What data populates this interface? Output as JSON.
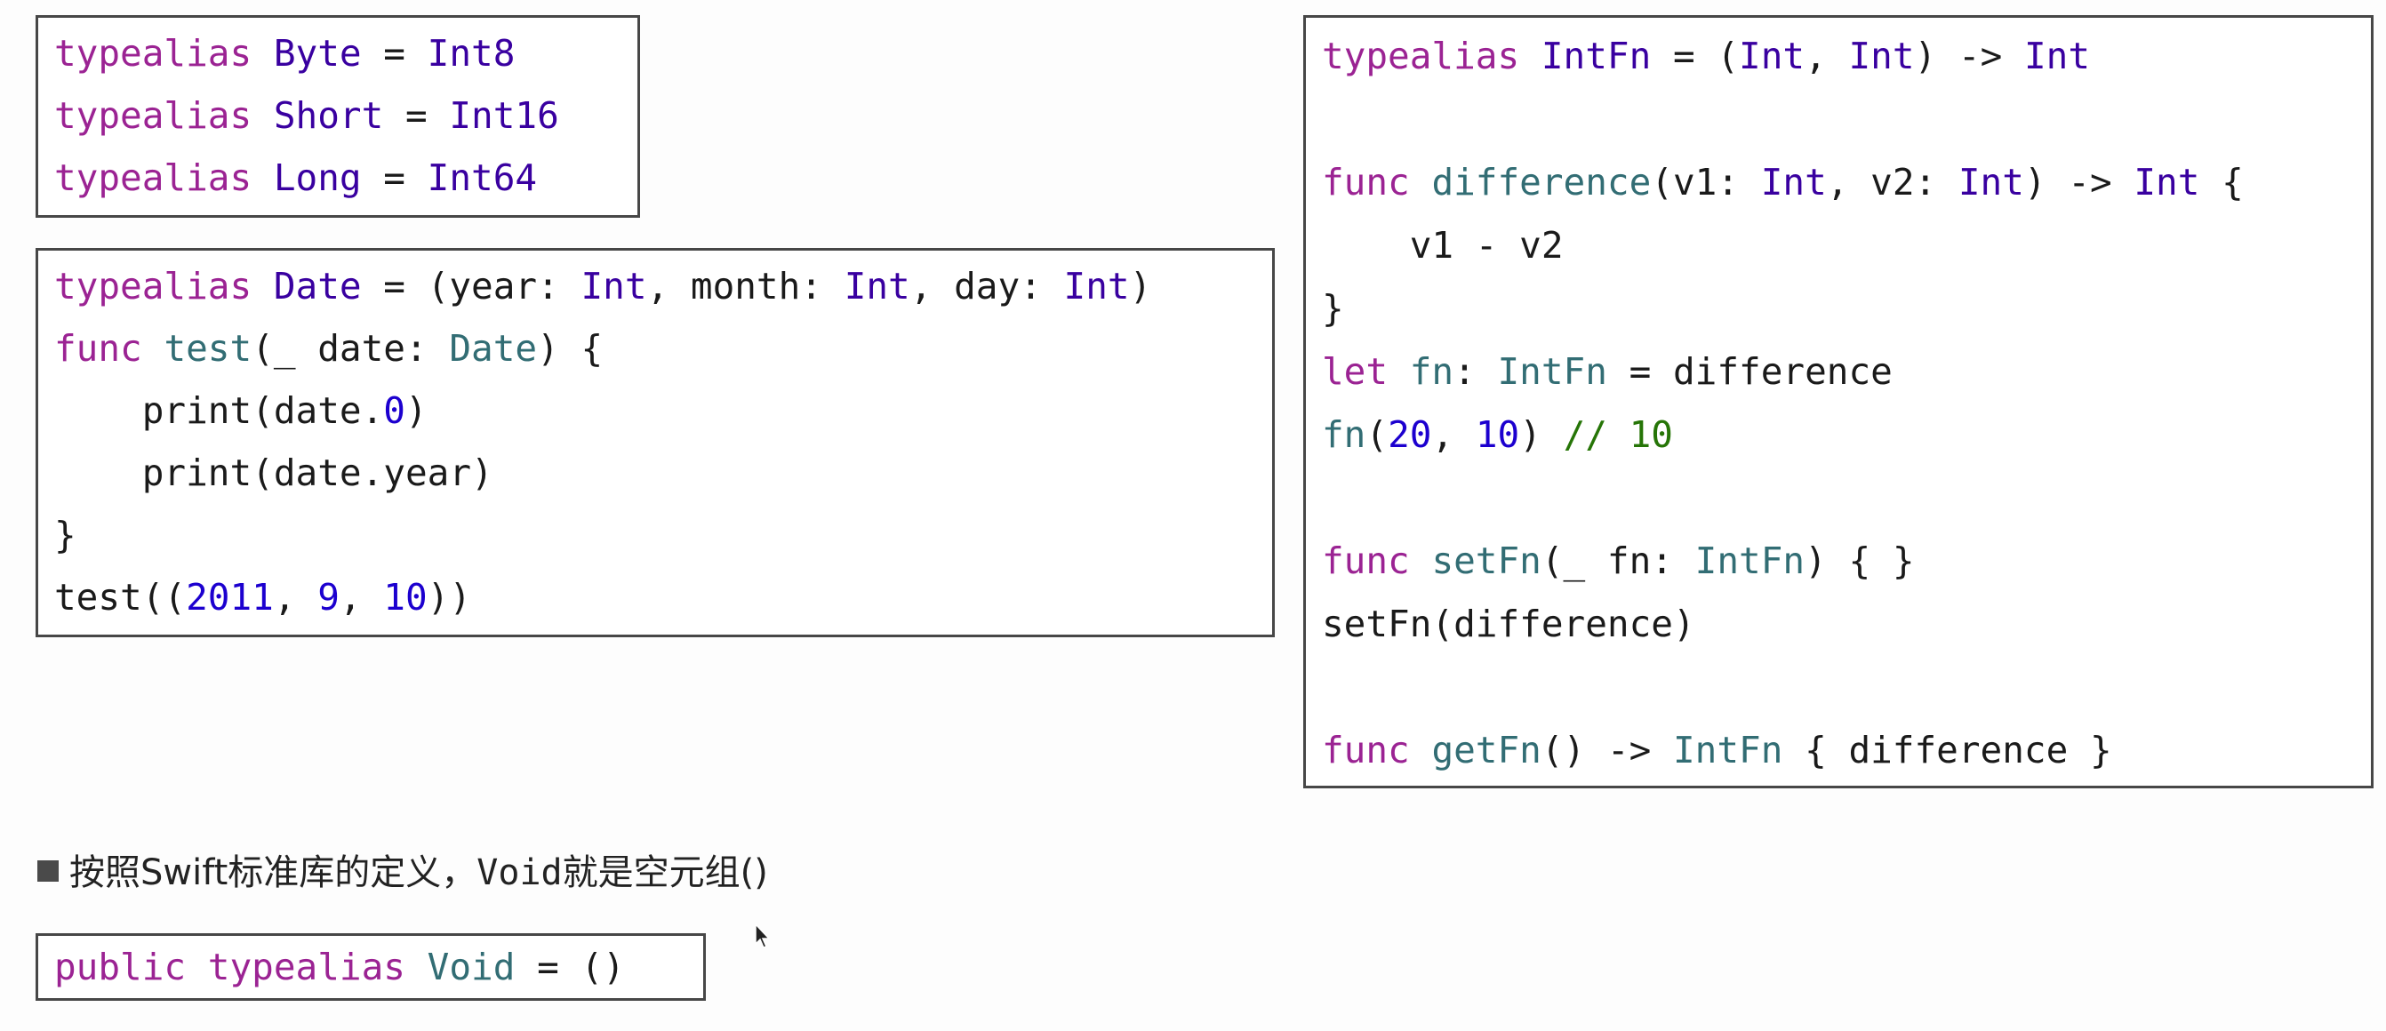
{
  "colors": {
    "keyword": "#9b2393",
    "type": "#3900a0",
    "identifier": "#326d74",
    "number": "#1c00cf",
    "comment": "#267507",
    "plain": "#1a1a1a",
    "border": "#474747"
  },
  "box_aliases": {
    "lines": [
      [
        [
          "kw",
          "typealias"
        ],
        [
          "pl",
          " "
        ],
        [
          "ty",
          "Byte"
        ],
        [
          "pl",
          " = "
        ],
        [
          "ty",
          "Int8"
        ]
      ],
      [
        [
          "kw",
          "typealias"
        ],
        [
          "pl",
          " "
        ],
        [
          "ty",
          "Short"
        ],
        [
          "pl",
          " = "
        ],
        [
          "ty",
          "Int16"
        ]
      ],
      [
        [
          "kw",
          "typealias"
        ],
        [
          "pl",
          " "
        ],
        [
          "ty",
          "Long"
        ],
        [
          "pl",
          " = "
        ],
        [
          "ty",
          "Int64"
        ]
      ]
    ]
  },
  "box_date": {
    "lines": [
      [
        [
          "kw",
          "typealias"
        ],
        [
          "pl",
          " "
        ],
        [
          "ty",
          "Date"
        ],
        [
          "pl",
          " = (year: "
        ],
        [
          "ty",
          "Int"
        ],
        [
          "pl",
          ", month: "
        ],
        [
          "ty",
          "Int"
        ],
        [
          "pl",
          ", day: "
        ],
        [
          "ty",
          "Int"
        ],
        [
          "pl",
          ")"
        ]
      ],
      [
        [
          "kw",
          "func"
        ],
        [
          "pl",
          " "
        ],
        [
          "id",
          "test"
        ],
        [
          "pl",
          "(_ date: "
        ],
        [
          "id",
          "Date"
        ],
        [
          "pl",
          ") {"
        ]
      ],
      [
        [
          "pl",
          "    print(date."
        ],
        [
          "nu",
          "0"
        ],
        [
          "pl",
          ")"
        ]
      ],
      [
        [
          "pl",
          "    print(date.year)"
        ]
      ],
      [
        [
          "pl",
          "}"
        ]
      ],
      [
        [
          "pl",
          "test(("
        ],
        [
          "nu",
          "2011"
        ],
        [
          "pl",
          ", "
        ],
        [
          "nu",
          "9"
        ],
        [
          "pl",
          ", "
        ],
        [
          "nu",
          "10"
        ],
        [
          "pl",
          "))"
        ]
      ]
    ]
  },
  "box_intfn": {
    "lines": [
      [
        [
          "kw",
          "typealias"
        ],
        [
          "pl",
          " "
        ],
        [
          "ty",
          "IntFn"
        ],
        [
          "pl",
          " = ("
        ],
        [
          "ty",
          "Int"
        ],
        [
          "pl",
          ", "
        ],
        [
          "ty",
          "Int"
        ],
        [
          "pl",
          ") -> "
        ],
        [
          "ty",
          "Int"
        ]
      ],
      [],
      [
        [
          "kw",
          "func"
        ],
        [
          "pl",
          " "
        ],
        [
          "id",
          "difference"
        ],
        [
          "pl",
          "(v1: "
        ],
        [
          "ty",
          "Int"
        ],
        [
          "pl",
          ", v2: "
        ],
        [
          "ty",
          "Int"
        ],
        [
          "pl",
          ") -> "
        ],
        [
          "ty",
          "Int"
        ],
        [
          "pl",
          " {"
        ]
      ],
      [
        [
          "pl",
          "    v1 - v2"
        ]
      ],
      [
        [
          "pl",
          "}"
        ]
      ],
      [
        [
          "kw",
          "let"
        ],
        [
          "pl",
          " "
        ],
        [
          "id",
          "fn"
        ],
        [
          "pl",
          ": "
        ],
        [
          "id",
          "IntFn"
        ],
        [
          "pl",
          " = difference"
        ]
      ],
      [
        [
          "id",
          "fn"
        ],
        [
          "pl",
          "("
        ],
        [
          "nu",
          "20"
        ],
        [
          "pl",
          ", "
        ],
        [
          "nu",
          "10"
        ],
        [
          "pl",
          ") "
        ],
        [
          "cm",
          "// 10"
        ]
      ],
      [],
      [
        [
          "kw",
          "func"
        ],
        [
          "pl",
          " "
        ],
        [
          "id",
          "setFn"
        ],
        [
          "pl",
          "(_ fn: "
        ],
        [
          "id",
          "IntFn"
        ],
        [
          "pl",
          ") { }"
        ]
      ],
      [
        [
          "pl",
          "setFn(difference)"
        ]
      ],
      [],
      [
        [
          "kw",
          "func"
        ],
        [
          "pl",
          " "
        ],
        [
          "id",
          "getFn"
        ],
        [
          "pl",
          "() -> "
        ],
        [
          "id",
          "IntFn"
        ],
        [
          "pl",
          " { difference }"
        ]
      ]
    ]
  },
  "bullet": {
    "text_before": "按照Swift标准库的定义，",
    "code": "Void",
    "text_after": "就是空元组()"
  },
  "box_void": {
    "lines": [
      [
        [
          "kw",
          "public"
        ],
        [
          "pl",
          " "
        ],
        [
          "kw",
          "typealias"
        ],
        [
          "pl",
          " "
        ],
        [
          "id",
          "Void"
        ],
        [
          "pl",
          " = ()"
        ]
      ]
    ]
  },
  "icons": {
    "bullet": "square-bullet-icon",
    "cursor": "mouse-pointer-icon"
  }
}
